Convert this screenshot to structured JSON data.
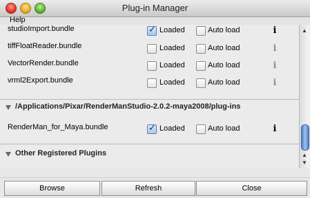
{
  "window": {
    "title": "Plug-in Manager"
  },
  "menu": {
    "help_label": "Help"
  },
  "columns": {
    "loaded_label": "Loaded",
    "autoload_label": "Auto load"
  },
  "sections": {
    "first_rows": [
      {
        "name": "studioImport.bundle",
        "loaded": true,
        "autoload": false,
        "info": "i"
      },
      {
        "name": "tiffFloatReader.bundle",
        "loaded": false,
        "autoload": false,
        "info": "i"
      },
      {
        "name": "VectorRender.bundle",
        "loaded": false,
        "autoload": false,
        "info": "i"
      },
      {
        "name": "vrml2Export.bundle",
        "loaded": false,
        "autoload": false,
        "info": "i"
      }
    ],
    "renderman": {
      "title": "/Applications/Pixar/RenderManStudio-2.0.2-maya2008/plug-ins",
      "rows": [
        {
          "name": "RenderMan_for_Maya.bundle",
          "loaded": true,
          "autoload": false,
          "info": "i"
        }
      ]
    },
    "other": {
      "title": "Other Registered Plugins"
    }
  },
  "buttons": {
    "browse": "Browse",
    "refresh": "Refresh",
    "close": "Close"
  },
  "colors": {
    "accent": "#4f7ec4",
    "checked_fill": "#a9c6ef"
  },
  "icons": {
    "info": "info-icon",
    "disclosure": "disclosure-triangle-icon"
  }
}
